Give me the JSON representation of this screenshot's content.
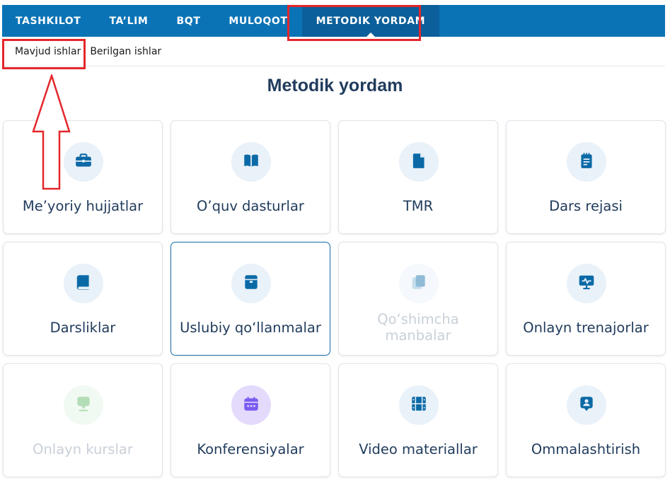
{
  "top_nav": {
    "items": [
      {
        "label": "TASHKILOT"
      },
      {
        "label": "TA’LIM"
      },
      {
        "label": "BQT"
      },
      {
        "label": "MULOQOT"
      },
      {
        "label": "METODIK YORDAM",
        "active": true
      }
    ]
  },
  "sub_nav": {
    "items": [
      {
        "label": "Mavjud ishlar",
        "highlighted": true
      },
      {
        "label": "Berilgan ishlar"
      }
    ]
  },
  "page": {
    "title": "Metodik yordam"
  },
  "cards": [
    {
      "label": "Me’yoriy hujjatlar",
      "icon": "briefcase-icon"
    },
    {
      "label": "O’quv dasturlar",
      "icon": "book-open-icon"
    },
    {
      "label": "TMR",
      "icon": "document-icon"
    },
    {
      "label": "Dars rejasi",
      "icon": "notepad-icon"
    },
    {
      "label": "Darsliklar",
      "icon": "book-icon"
    },
    {
      "label": "Uslubiy qo‘llanmalar",
      "icon": "manual-icon",
      "selected": true
    },
    {
      "label": "Qo‘shimcha manbalar",
      "icon": "copy-icon",
      "disabled": true
    },
    {
      "label": "Onlayn trenajorlar",
      "icon": "monitor-icon"
    },
    {
      "label": "Onlayn kurslar",
      "icon": "chat-icon",
      "disabled": true
    },
    {
      "label": "Konferensiyalar",
      "icon": "calendar-icon"
    },
    {
      "label": "Video materiallar",
      "icon": "film-icon"
    },
    {
      "label": "Ommalashtirish",
      "icon": "person-badge-icon"
    }
  ],
  "colors": {
    "nav_bg": "#0a73b5",
    "nav_active_bg": "#0b5f9a",
    "icon_blue": "#0b6aa6",
    "icon_purple": "#7b5cf0",
    "icon_green": "#59b65f",
    "highlight_red": "#e3262b",
    "title_text": "#213c5d"
  }
}
